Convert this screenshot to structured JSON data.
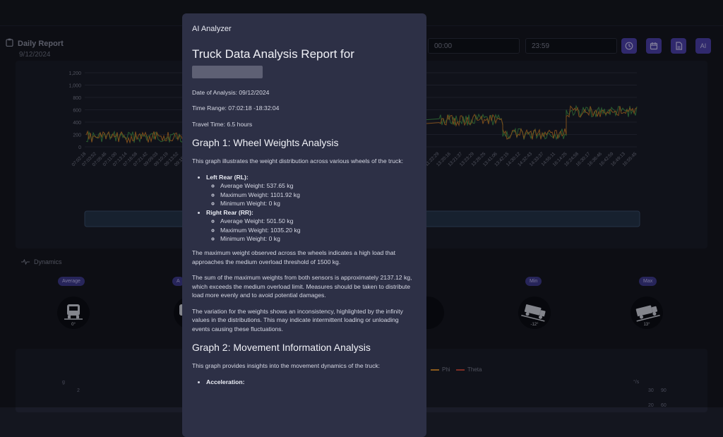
{
  "header": {
    "title": "Daily Report",
    "date": "9/12/2024"
  },
  "time_range": {
    "start": "00:00",
    "end": "23:59"
  },
  "toolbar": {
    "ai_label": "AI"
  },
  "weights_chart": {
    "y_ticks": [
      "1,200",
      "1,000",
      "800",
      "600",
      "400",
      "200",
      "0"
    ],
    "x_ticks_left": [
      "07:02:18",
      "07:03:52",
      "07:05:46",
      "07:11:00",
      "07:13:14",
      "07:16:58",
      "07:21:42",
      "09:09:03",
      "09:10:19",
      "09:13:52",
      "09:15:55",
      "09:18:41"
    ],
    "x_ticks_right": [
      "11:22:29",
      "13:20:16",
      "13:21:37",
      "13:23:29",
      "13:26:25",
      "13:41:06",
      "13:42:15",
      "14:30:12",
      "14:32:43",
      "14:33:37",
      "14:55:11",
      "16:14:25",
      "16:24:58",
      "16:30:17",
      "16:36:46",
      "16:42:59",
      "16:49:13",
      "16:55:45"
    ]
  },
  "dynamics": {
    "label": "Dynamics",
    "pills": [
      "Average",
      "A",
      "Min",
      "Max"
    ],
    "gauges": [
      "0°",
      "-12°",
      "13°"
    ]
  },
  "movement_chart": {
    "left_axis_unit": "g",
    "left_tick": "2",
    "right_axis_unit": "°/s",
    "right_ticks_a": [
      "30",
      "20"
    ],
    "right_ticks_b": [
      "90",
      "60"
    ],
    "legend": [
      {
        "name": "Phi",
        "color": "#d4892a"
      },
      {
        "name": "Theta",
        "color": "#c4473a"
      }
    ]
  },
  "modal": {
    "title": "AI Analyzer",
    "heading": "Truck Data Analysis Report for",
    "date_line": "Date of Analysis: 09/12/2024",
    "time_line": "Time Range: 07:02:18 -18:32:04",
    "travel_line": "Travel Time: 6.5 hours",
    "graph1_title": "Graph 1: Wheel Weights Analysis",
    "graph1_intro": "This graph illustrates the weight distribution across various wheels of the truck:",
    "left_rear": {
      "label": "Left Rear (RL):",
      "avg": "Average Weight: 537.65 kg",
      "max": "Maximum Weight: 1101.92 kg",
      "min": "Minimum Weight: 0 kg"
    },
    "right_rear": {
      "label": "Right Rear (RR):",
      "avg": "Average Weight: 501.50 kg",
      "max": "Maximum Weight: 1035.20 kg",
      "min": "Minimum Weight: 0 kg"
    },
    "para1": "The maximum weight observed across the wheels indicates a high load that approaches the medium overload threshold of 1500 kg.",
    "para2": "The sum of the maximum weights from both sensors is approximately 2137.12 kg, which exceeds the medium overload limit. Measures should be taken to distribute load more evenly and to avoid potential damages.",
    "para3": "The variation for the weights shows an inconsistency, highlighted by the infinity values in the distributions. This may indicate intermittent loading or unloading events causing these fluctuations.",
    "graph2_title": "Graph 2: Movement Information Analysis",
    "graph2_intro": "This graph provides insights into the movement dynamics of the truck:",
    "accel_label": "Acceleration:"
  }
}
